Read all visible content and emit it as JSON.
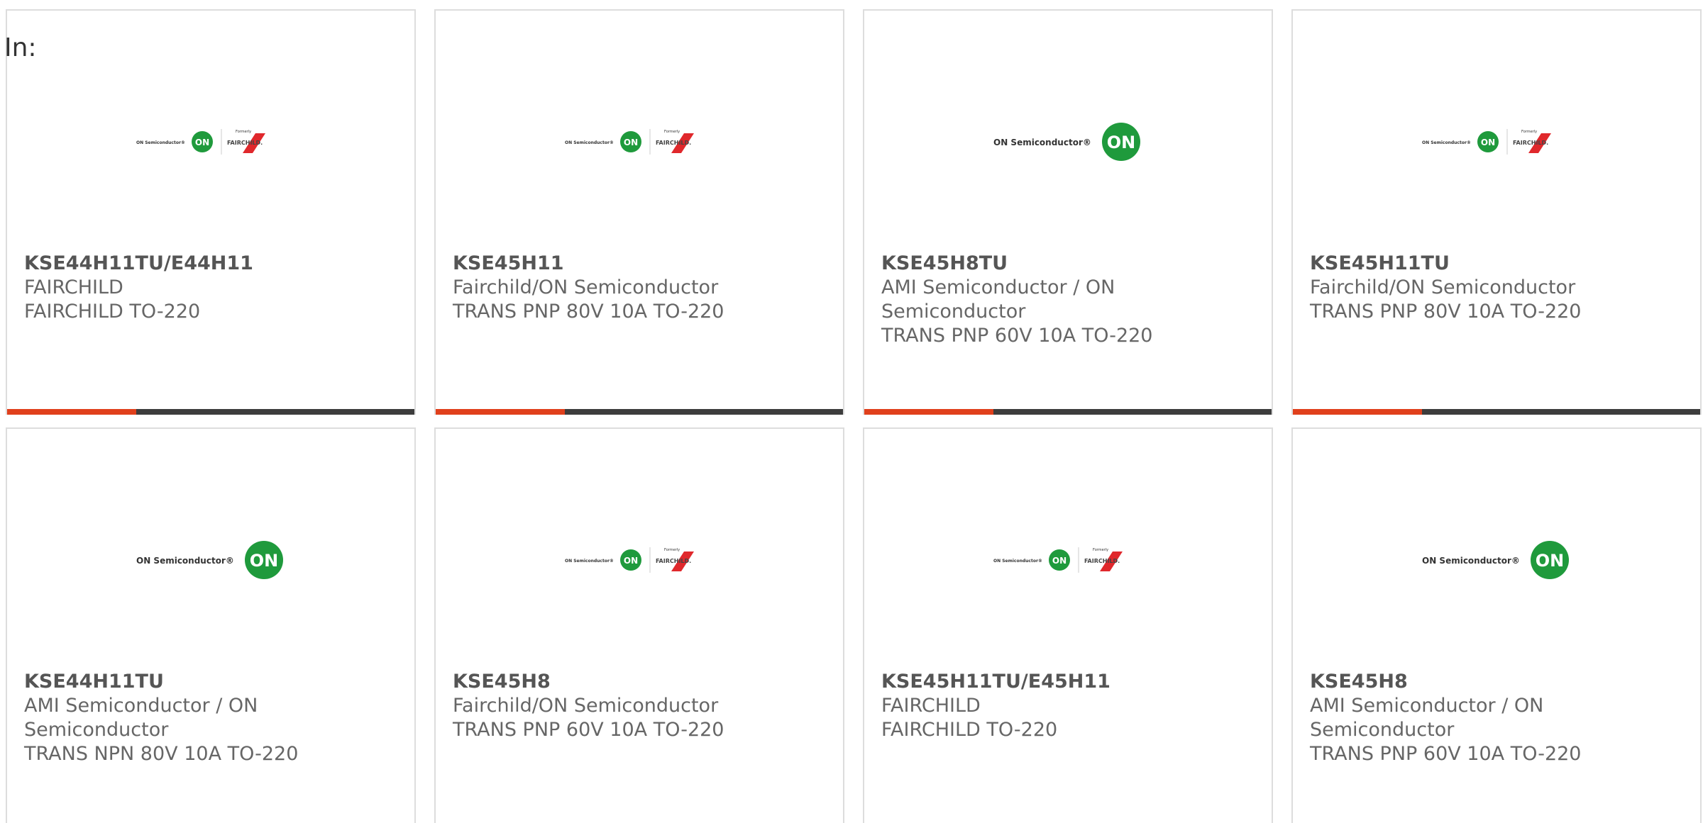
{
  "header": {
    "in_label": "In:"
  },
  "colors": {
    "accent": "#e0401c",
    "bar_dark": "#3d3d3d",
    "on_green": "#1f9a3c",
    "fairchild_red": "#e0282c"
  },
  "logos": {
    "on_text": "ON Semiconductor®",
    "on_mark": "ON",
    "formerly": "Formerly",
    "fairchild": "FAIRCHILD."
  },
  "products": [
    {
      "part": "KSE44H11TU/E44H11",
      "manufacturer": "FAIRCHILD",
      "description": "FAIRCHILD TO-220",
      "logo": "on-fairchild-logo"
    },
    {
      "part": "KSE45H11",
      "manufacturer": "Fairchild/ON Semiconductor",
      "description": "TRANS PNP 80V 10A TO-220",
      "logo": "on-fairchild-logo"
    },
    {
      "part": "KSE45H8TU",
      "manufacturer": "AMI Semiconductor / ON Semiconductor",
      "description": "TRANS PNP 60V 10A TO-220",
      "logo": "on-semiconductor-logo"
    },
    {
      "part": "KSE45H11TU",
      "manufacturer": "Fairchild/ON Semiconductor",
      "description": "TRANS PNP 80V 10A TO-220",
      "logo": "on-fairchild-logo"
    },
    {
      "part": "KSE44H11TU",
      "manufacturer": "AMI Semiconductor / ON Semiconductor",
      "description": "TRANS NPN 80V 10A TO-220",
      "logo": "on-semiconductor-logo"
    },
    {
      "part": "KSE45H8",
      "manufacturer": "Fairchild/ON Semiconductor",
      "description": "TRANS PNP 60V 10A TO-220",
      "logo": "on-fairchild-logo"
    },
    {
      "part": "KSE45H11TU/E45H11",
      "manufacturer": "FAIRCHILD",
      "description": "FAIRCHILD TO-220",
      "logo": "on-fairchild-logo"
    },
    {
      "part": "KSE45H8",
      "manufacturer": "AMI Semiconductor / ON Semiconductor",
      "description": "TRANS PNP 60V 10A TO-220",
      "logo": "on-semiconductor-logo"
    }
  ]
}
